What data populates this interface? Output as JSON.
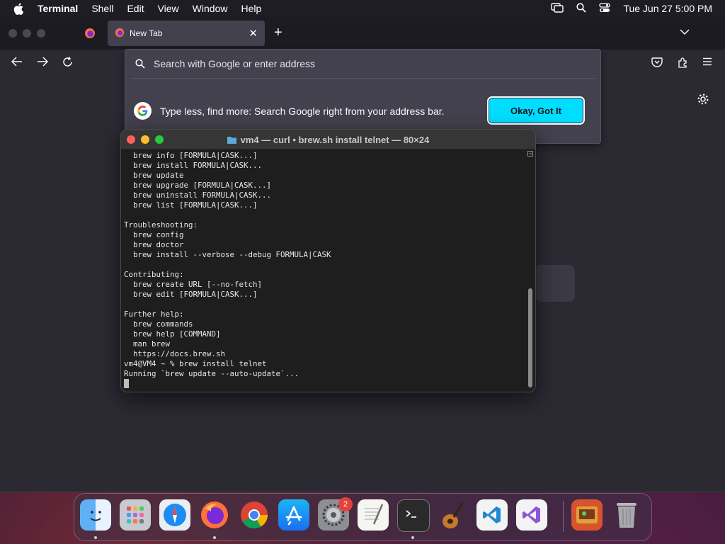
{
  "menubar": {
    "app": "Terminal",
    "items": [
      "Shell",
      "Edit",
      "View",
      "Window",
      "Help"
    ],
    "clock": "Tue Jun 27  5:00 PM"
  },
  "browser": {
    "tab_title": "New Tab",
    "url_placeholder": "Search with Google or enter address",
    "tip_text": "Type less, find more: Search Google right from your address bar.",
    "tip_button": "Okay, Got It"
  },
  "terminal": {
    "title": "vm4 — curl • brew.sh install telnet — 80×24",
    "lines": [
      "  brew info [FORMULA|CASK...]",
      "  brew install FORMULA|CASK...",
      "  brew update",
      "  brew upgrade [FORMULA|CASK...]",
      "  brew uninstall FORMULA|CASK...",
      "  brew list [FORMULA|CASK...]",
      "",
      "Troubleshooting:",
      "  brew config",
      "  brew doctor",
      "  brew install --verbose --debug FORMULA|CASK",
      "",
      "Contributing:",
      "  brew create URL [--no-fetch]",
      "  brew edit [FORMULA|CASK...]",
      "",
      "Further help:",
      "  brew commands",
      "  brew help [COMMAND]",
      "  man brew",
      "  https://docs.brew.sh",
      "vm4@VM4 ~ % brew install telnet",
      "Running `brew update --auto-update`..."
    ]
  },
  "dock": {
    "settings_badge": "2",
    "apps": [
      "finder",
      "launchpad",
      "safari",
      "firefox",
      "chrome",
      "app-store",
      "system-settings",
      "textedit",
      "terminal",
      "garageband",
      "vscode",
      "visual-studio",
      "photo-app",
      "trash"
    ]
  }
}
